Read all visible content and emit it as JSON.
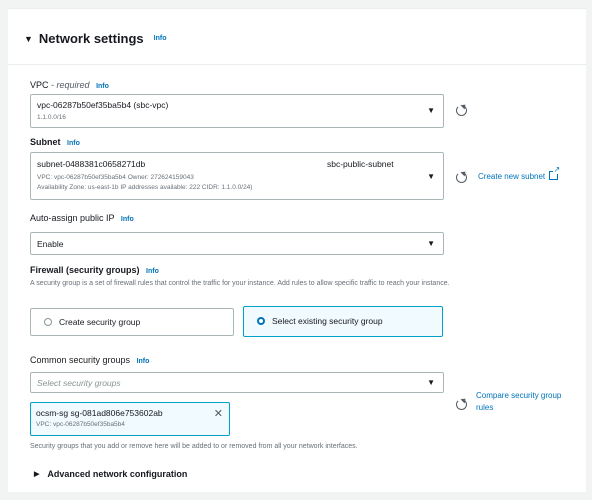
{
  "section": {
    "title": "Network settings",
    "info": "Info"
  },
  "vpc": {
    "label": "VPC",
    "label_suffix": " - required",
    "info": "Info",
    "value": "vpc-06287b50ef35ba5b4 (sbc-vpc)",
    "cidr": "1.1.0.0/16"
  },
  "subnet": {
    "label": "Subnet",
    "info": "Info",
    "id": "subnet-0488381c0658271db",
    "name": "sbc-public-subnet",
    "details_line1": "VPC: vpc-06287b50ef35ba5b4      Owner: 272624159043",
    "details_line2": "Availability Zone: us-east-1b      IP addresses available: 222      CIDR: 1.1.0.0/24)",
    "create_link": "Create new subnet"
  },
  "public_ip": {
    "label": "Auto-assign public IP",
    "info": "Info",
    "value": "Enable"
  },
  "firewall": {
    "label": "Firewall (security groups)",
    "info": "Info",
    "description": "A security group is a set of firewall rules that control the traffic for your instance. Add rules to allow specific traffic to reach your instance.",
    "option_create": "Create security group",
    "option_select": "Select existing security group",
    "selected": "select"
  },
  "common_sg": {
    "label": "Common security groups",
    "info": "Info",
    "placeholder": "Select security groups",
    "compare_link": "Compare security group rules",
    "token_main": "ocsm-sg   sg-081ad806e753602ab",
    "token_sub": "VPC: vpc-06287b50ef35ba5b4",
    "note": "Security groups that you add or remove here will be added to or removed from all your network interfaces."
  },
  "advanced": {
    "label": "Advanced network configuration"
  },
  "icons": [
    "caret-down-icon",
    "caret-right-icon",
    "refresh-icon",
    "external-link-icon",
    "close-icon"
  ],
  "colors": {
    "accent": "#0073bb",
    "selected_border": "#00a1c9",
    "border": "#aab7b8",
    "background": "#f2f3f3"
  }
}
